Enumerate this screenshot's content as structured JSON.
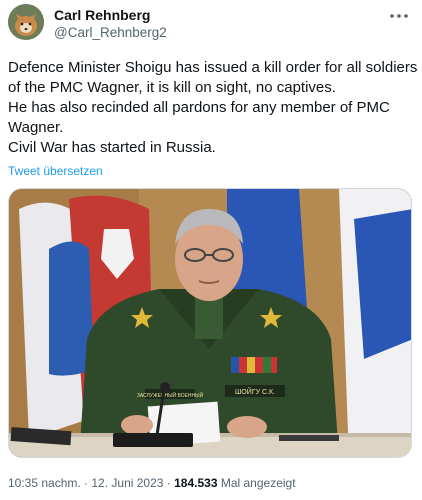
{
  "author": {
    "name": "Carl Rehnberg",
    "handle": "@Carl_Rehnberg2"
  },
  "more_icon": "more-horizontal-icon",
  "tweet": {
    "lines": [
      "Defence Minister Shoigu has issued a kill order for all soldiers",
      "of the PMC Wagner, it is kill on sight, no captives.",
      "He has also recinded all pardons for any member of PMC",
      "Wagner.",
      "Civil War has started in Russia."
    ],
    "translate_label": "Tweet übersetzen"
  },
  "photo": {
    "name_tag": "ШОЙГУ С.К.",
    "chest_tag": "ЗАСЛУЖЕННЫЙ ВОЕННЫЙ"
  },
  "footer": {
    "time_date": "10:35 nachm. · 12. Juni 2023 · ",
    "views_count": "184.533",
    "views_label": " Mal angezeigt"
  },
  "colors": {
    "link": "#1d9bf0",
    "secondary_text": "#536471",
    "uniform": "#2f4a2a",
    "flag_blue": "#2754a8",
    "flag_red": "#c8302b"
  }
}
